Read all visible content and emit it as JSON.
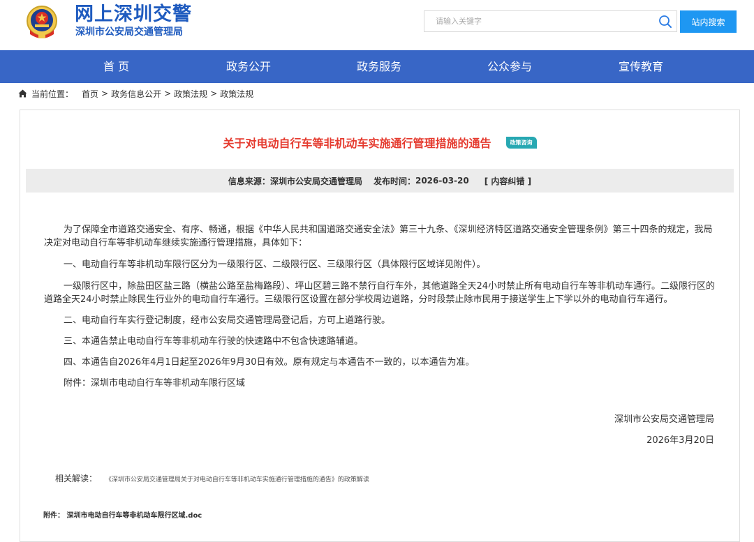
{
  "header": {
    "site_title": "网上深圳交警",
    "site_subtitle": "深圳市公安局交通管理局",
    "search": {
      "placeholder": "请输入关键字"
    },
    "search_button": "站内搜索"
  },
  "nav": {
    "items": [
      "首 页",
      "政务公开",
      "政务服务",
      "公众参与",
      "宣传教育"
    ]
  },
  "breadcrumb": {
    "label": "当前位置：",
    "items": [
      "首页",
      "政务信息公开",
      "政策法规",
      "政策法规"
    ],
    "separator": ">"
  },
  "article": {
    "title": "关于对电动自行车等非机动车实施通行管理措施的通告",
    "badge": "政策咨询",
    "source_label": "信息来源：",
    "source": "深圳市公安局交通管理局",
    "time_label": "发布时间：",
    "time": "2026-03-20",
    "correction": "[ 内容纠错 ]",
    "paragraphs": [
      "为了保障全市道路交通安全、有序、畅通，根据《中华人民共和国道路交通安全法》第三十九条、《深圳经济特区道路交通安全管理条例》第三十四条的规定，我局决定对电动自行车等非机动车继续实施通行管理措施，具体如下：",
      "一、电动自行车等非机动车限行区分为一级限行区、二级限行区、三级限行区（具体限行区域详见附件）。",
      "一级限行区中，除盐田区盐三路（横盐公路至盐梅路段）、坪山区碧三路不禁行自行车外，其他道路全天24小时禁止所有电动自行车等非机动车通行。二级限行区的道路全天24小时禁止除民生行业外的电动自行车通行。三级限行区设置在部分学校周边道路，分时段禁止除市民用于接送学生上下学以外的电动自行车通行。",
      "二、电动自行车实行登记制度，经市公安局交通管理局登记后，方可上道路行驶。",
      "三、本通告禁止电动自行车等非机动车行驶的快速路中不包含快速路辅道。",
      "四、本通告自2026年4月1日起至2026年9月30日有效。原有规定与本通告不一致的，以本通告为准。",
      "附件：深圳市电动自行车等非机动车限行区域"
    ],
    "signature_org": "深圳市公安局交通管理局",
    "signature_date": "2026年3月20日",
    "related_label": "相关解读：",
    "related_link": "《深圳市公安局交通管理局关于对电动自行车等非机动车实施通行管理措施的通告》的政策解读",
    "attachment_label": "附件：",
    "attachment_file": "深圳市电动自行车等非机动车限行区域.doc"
  },
  "colors": {
    "brand_blue": "#1f5bbf",
    "nav_bg": "#3866c6",
    "search_button": "#1e97f2",
    "title_red": "#e53b2f",
    "badge_teal": "#27a8b2"
  },
  "icons": [
    "police-emblem-icon",
    "search-icon",
    "home-icon"
  ]
}
